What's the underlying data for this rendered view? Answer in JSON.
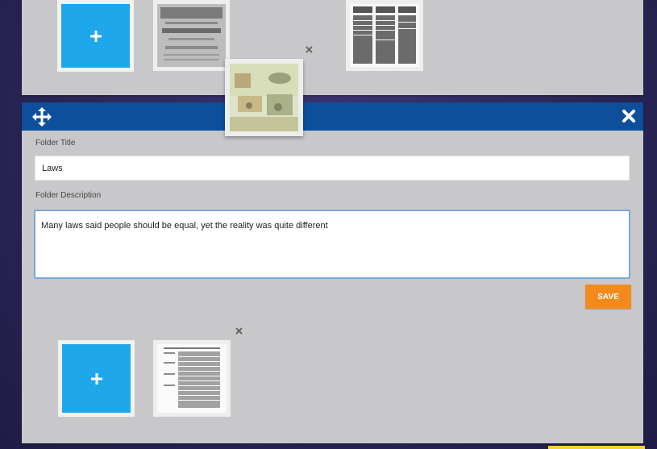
{
  "folder_form": {
    "title_label": "Folder Title",
    "title_value": "Laws",
    "description_label": "Folder Description",
    "description_value": "Many laws said people should be equal, yet the reality was quite different",
    "save_label": "SAVE"
  },
  "icons": {
    "add": "plus-icon",
    "move": "move-arrows-icon",
    "close": "close-icon",
    "remove": "remove-x-icon"
  },
  "colors": {
    "header": "#0d4f9b",
    "add_tile": "#1fa7eb",
    "save_button": "#f28a1c",
    "panel": "#c8c8cb"
  }
}
